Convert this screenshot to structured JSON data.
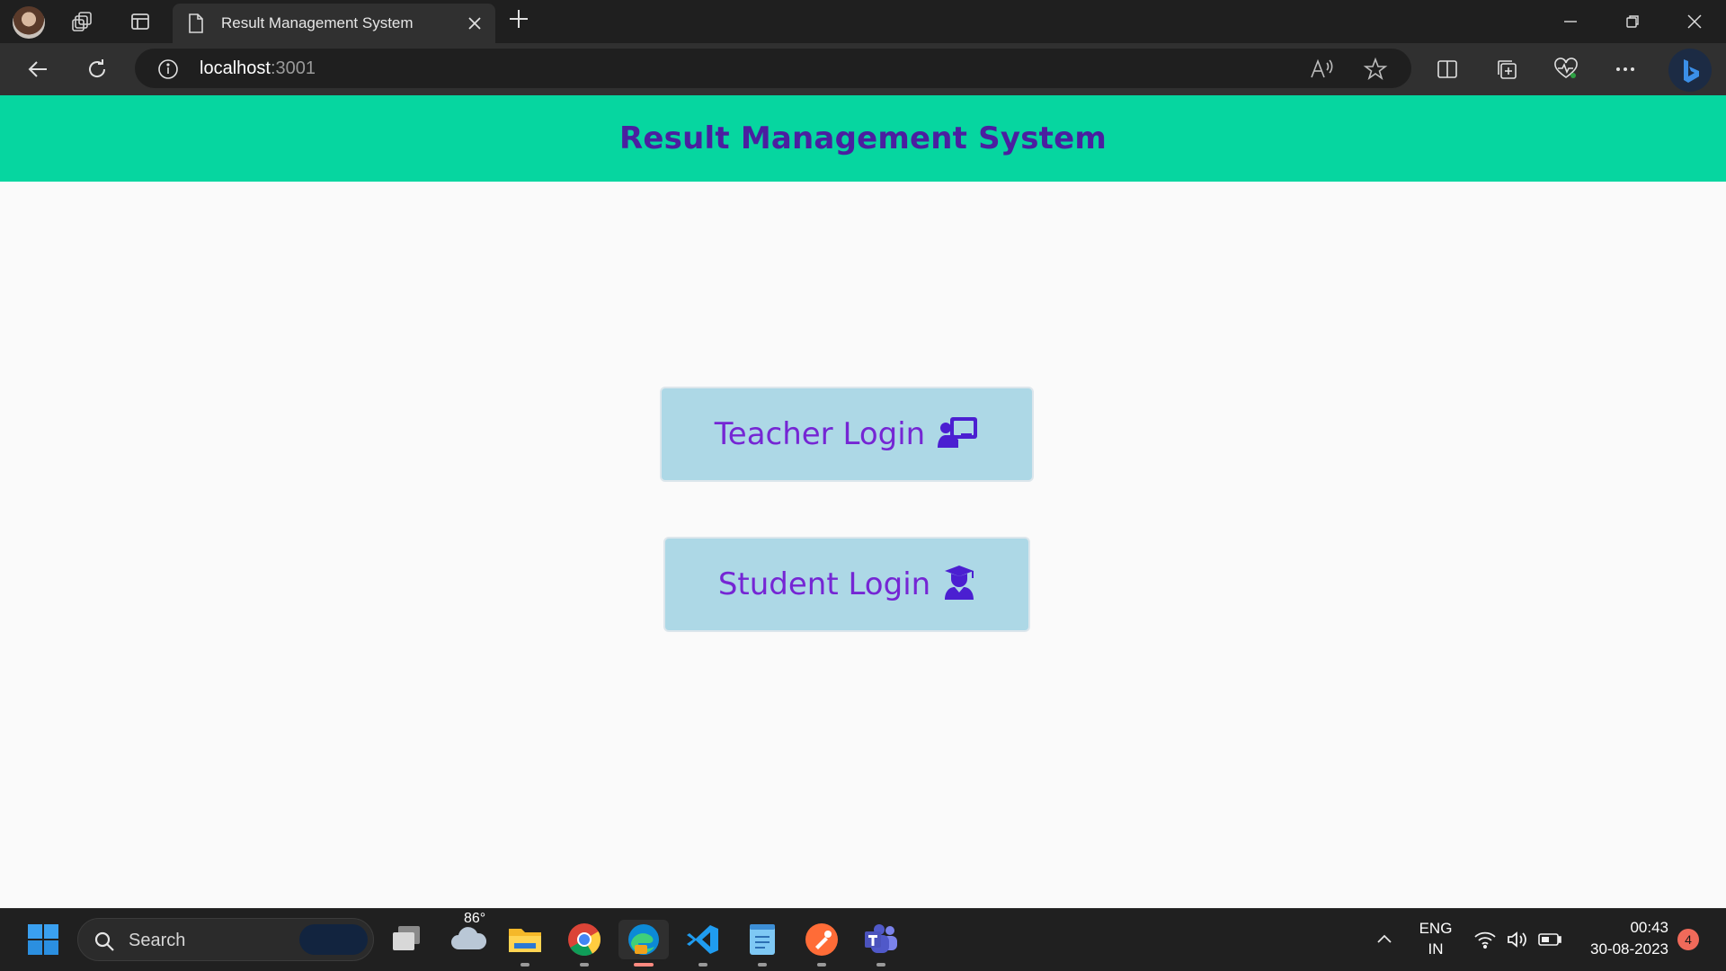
{
  "browser": {
    "tab_title": "Result Management System",
    "address_host": "localhost",
    "address_port": ":3001"
  },
  "app": {
    "title": "Result Management System",
    "colors": {
      "header": "#06d6a0",
      "title": "#4b1fa0",
      "button_bg": "#add8e6",
      "button_text": "#7526d4"
    },
    "buttons": [
      {
        "label": "Teacher Login",
        "icon": "chalkboard-teacher-icon"
      },
      {
        "label": "Student Login",
        "icon": "user-graduate-icon"
      }
    ]
  },
  "taskbar": {
    "search_placeholder": "Search",
    "weather_temp": "86°",
    "language_line1": "ENG",
    "language_line2": "IN",
    "time": "00:43",
    "date": "30-08-2023",
    "notification_count": "4"
  }
}
